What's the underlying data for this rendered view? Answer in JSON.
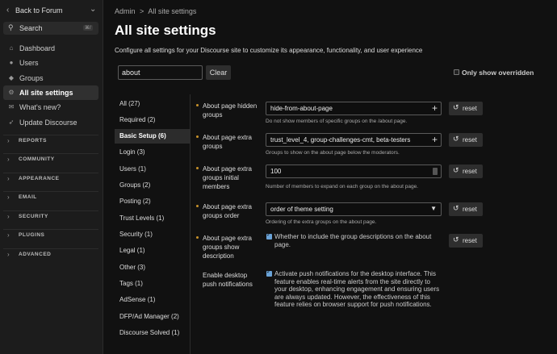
{
  "sidebar": {
    "back_label": "Back to Forum",
    "search_label": "Search",
    "search_shortcut": "⌘/",
    "items": [
      {
        "label": "Dashboard"
      },
      {
        "label": "Users"
      },
      {
        "label": "Groups"
      },
      {
        "label": "All site settings"
      },
      {
        "label": "What's new?"
      },
      {
        "label": "Update Discourse"
      }
    ],
    "sections": [
      {
        "label": "REPORTS"
      },
      {
        "label": "COMMUNITY"
      },
      {
        "label": "APPEARANCE"
      },
      {
        "label": "EMAIL"
      },
      {
        "label": "SECURITY"
      },
      {
        "label": "PLUGINS"
      },
      {
        "label": "ADVANCED"
      }
    ]
  },
  "breadcrumb": {
    "root": "Admin",
    "separator": ">",
    "current": "All site settings"
  },
  "page": {
    "title": "All site settings",
    "description": "Configure all settings for your Discourse site to customize its appearance, functionality, and user experience"
  },
  "filter": {
    "value": "about",
    "clear_label": "Clear",
    "only_overridden_label": "Only show overridden"
  },
  "categories": [
    {
      "label": "All (27)"
    },
    {
      "label": "Required (2)"
    },
    {
      "label": "Basic Setup (6)"
    },
    {
      "label": "Login (3)"
    },
    {
      "label": "Users (1)"
    },
    {
      "label": "Groups (2)"
    },
    {
      "label": "Posting (2)"
    },
    {
      "label": "Trust Levels (1)"
    },
    {
      "label": "Security (1)"
    },
    {
      "label": "Legal (1)"
    },
    {
      "label": "Other (3)"
    },
    {
      "label": "Tags (1)"
    },
    {
      "label": "AdSense (1)"
    },
    {
      "label": "DFP/Ad Manager (2)"
    },
    {
      "label": "Discourse Solved (1)"
    }
  ],
  "settings": [
    {
      "name": "About page hidden groups",
      "value": "hide-from-about-page",
      "help": "Do not show members of specific groups on the /about page.",
      "reset": "reset"
    },
    {
      "name": "About page extra groups",
      "value": "trust_level_4, group-challenges-cmt, beta-testers",
      "help": "Groups to show on the about page below the moderators.",
      "reset": "reset"
    },
    {
      "name": "About page extra groups initial members",
      "value": "100",
      "help": "Number of members to expand on each group on the about page.",
      "reset": "reset"
    },
    {
      "name": "About page extra groups order",
      "value": "order of theme setting",
      "help": "Ordering of the extra groups on the about page.",
      "reset": "reset"
    },
    {
      "name": "About page extra groups show description",
      "value": "Whether to include the group descriptions on the about page.",
      "reset": "reset"
    },
    {
      "name": "Enable desktop push notifications",
      "value": "Activate push notifications for the desktop interface. This feature enables real-time alerts from the site directly to your desktop, enhancing engagement and ensuring users are always updated. However, the effectiveness of this feature relies on browser support for push notifications."
    }
  ]
}
